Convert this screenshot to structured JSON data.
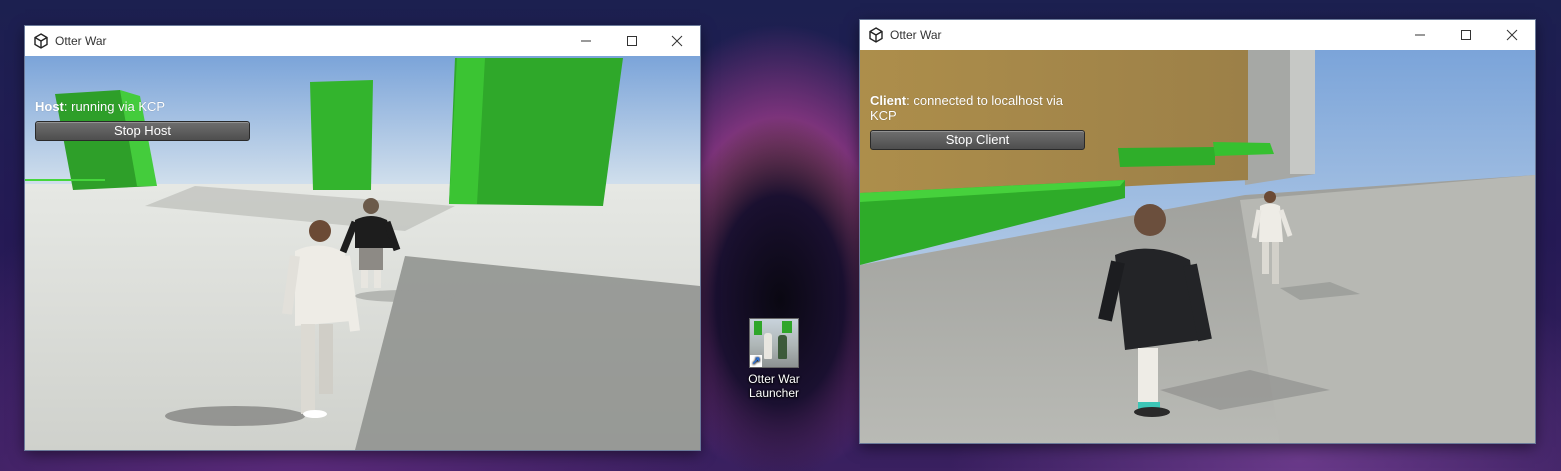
{
  "desktop": {
    "icon_label": "Otter War Launcher"
  },
  "host_window": {
    "title": "Otter War",
    "status_role": "Host",
    "status_text": ": running via KCP",
    "button_label": "Stop Host"
  },
  "client_window": {
    "title": "Otter War",
    "status_role": "Client",
    "status_text": ": connected to localhost via KCP",
    "button_label": "Stop Client"
  },
  "colors": {
    "green_block": "#2faa2a",
    "sky_top": "#7fa6d8",
    "ground": "#c9ccc6",
    "wall_tan": "#a88b4a"
  }
}
